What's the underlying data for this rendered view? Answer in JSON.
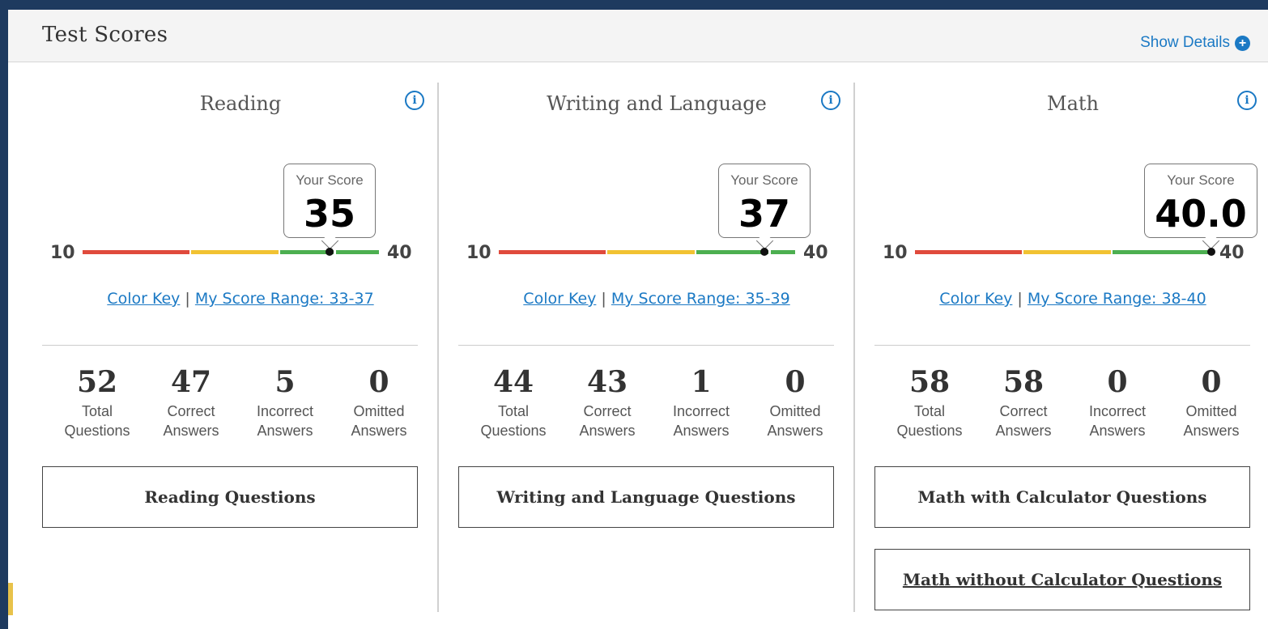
{
  "header": {
    "title": "Test Scores",
    "show_details": "Show Details",
    "show_details_icon": "plus-circle-icon"
  },
  "colors": {
    "accent": "#1b79c4",
    "scale_red": "#e04a3c",
    "scale_yellow": "#f1c232",
    "scale_green": "#4caf50",
    "background": "#1e3a5f"
  },
  "sections": [
    {
      "title": "Reading",
      "info_icon": "i",
      "your_score_label": "Your Score",
      "score": "35",
      "scale_min": "10",
      "scale_max": "40",
      "color_key": "Color Key",
      "separator": " | ",
      "score_range": "My Score Range: 33-37",
      "stats": [
        {
          "value": "52",
          "label1": "Total",
          "label2": "Questions"
        },
        {
          "value": "47",
          "label1": "Correct",
          "label2": "Answers"
        },
        {
          "value": "5",
          "label1": "Incorrect",
          "label2": "Answers"
        },
        {
          "value": "0",
          "label1": "Omitted",
          "label2": "Answers"
        }
      ],
      "buttons": [
        "Reading Questions"
      ]
    },
    {
      "title": "Writing and Language",
      "info_icon": "i",
      "your_score_label": "Your Score",
      "score": "37",
      "scale_min": "10",
      "scale_max": "40",
      "color_key": "Color Key",
      "separator": " | ",
      "score_range": "My Score Range: 35-39",
      "stats": [
        {
          "value": "44",
          "label1": "Total",
          "label2": "Questions"
        },
        {
          "value": "43",
          "label1": "Correct",
          "label2": "Answers"
        },
        {
          "value": "1",
          "label1": "Incorrect",
          "label2": "Answers"
        },
        {
          "value": "0",
          "label1": "Omitted",
          "label2": "Answers"
        }
      ],
      "buttons": [
        "Writing and Language Questions"
      ]
    },
    {
      "title": "Math",
      "info_icon": "i",
      "your_score_label": "Your Score",
      "score": "40.0",
      "scale_min": "10",
      "scale_max": "40",
      "color_key": "Color Key",
      "separator": " | ",
      "score_range": "My Score Range: 38-40",
      "stats": [
        {
          "value": "58",
          "label1": "Total",
          "label2": "Questions"
        },
        {
          "value": "58",
          "label1": "Correct",
          "label2": "Answers"
        },
        {
          "value": "0",
          "label1": "Incorrect",
          "label2": "Answers"
        },
        {
          "value": "0",
          "label1": "Omitted",
          "label2": "Answers"
        }
      ],
      "buttons": [
        "Math with Calculator Questions",
        "Math without Calculator Questions"
      ]
    }
  ]
}
